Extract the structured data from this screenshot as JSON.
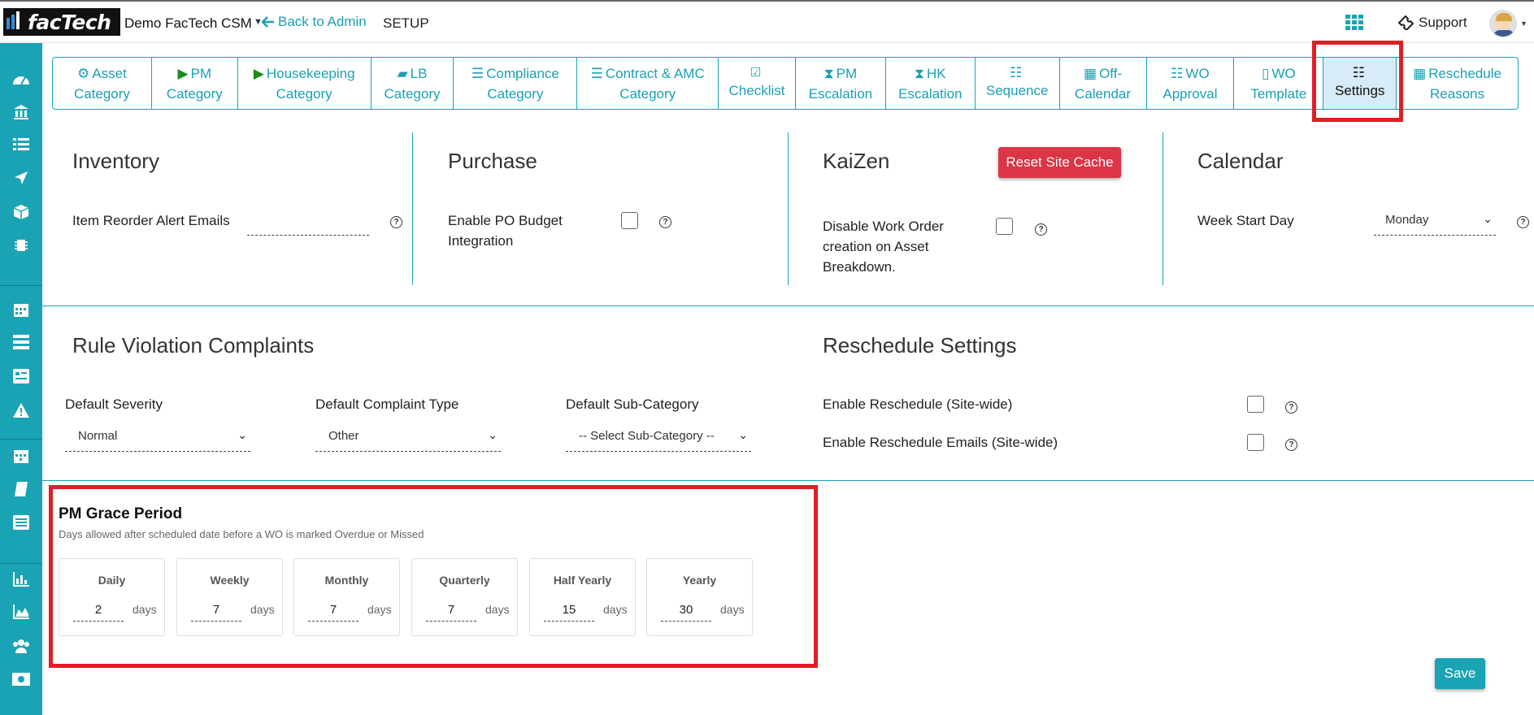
{
  "header": {
    "site_name": "Demo FacTech CSM",
    "back_link": "Back to Admin",
    "section": "SETUP",
    "support": "Support",
    "logo_text": "facTech"
  },
  "tabs": [
    {
      "label": "Asset Category",
      "icon": "cubes-icon"
    },
    {
      "label": "PM Category",
      "icon": "play-icon"
    },
    {
      "label": "Housekeeping Category",
      "icon": "play-icon"
    },
    {
      "label": "LB Category",
      "icon": "book-icon"
    },
    {
      "label": "Compliance Category",
      "icon": "list-icon"
    },
    {
      "label": "Contract & AMC Category",
      "icon": "list-icon"
    },
    {
      "label": "Checklist",
      "icon": "check-square-icon"
    },
    {
      "label": "PM Escalation",
      "icon": "hourglass-icon"
    },
    {
      "label": "HK Escalation",
      "icon": "hourglass-icon"
    },
    {
      "label": "Sequence",
      "icon": "list-ol-icon"
    },
    {
      "label": "Off-Calendar",
      "icon": "calendar-icon"
    },
    {
      "label": "WO Approval",
      "icon": "list-ol-icon"
    },
    {
      "label": "WO Template",
      "icon": "file-pdf-icon"
    },
    {
      "label": "Settings",
      "icon": "list-ol-icon",
      "active": true
    },
    {
      "label": "Reschedule Reasons",
      "icon": "calendar-icon"
    }
  ],
  "inventory": {
    "title": "Inventory",
    "reorder_label": "Item Reorder Alert Emails",
    "reorder_value": ""
  },
  "purchase": {
    "title": "Purchase",
    "po_budget_label": "Enable PO Budget Integration"
  },
  "kaizen": {
    "title": "KaiZen",
    "reset_button": "Reset Site Cache",
    "disable_wo_label": "Disable Work Order creation on Asset Breakdown."
  },
  "calendar": {
    "title": "Calendar",
    "week_start_label": "Week Start Day",
    "week_start_value": "Monday"
  },
  "rule_violation": {
    "title": "Rule Violation Complaints",
    "severity_label": "Default Severity",
    "severity_value": "Normal",
    "complaint_type_label": "Default Complaint Type",
    "complaint_type_value": "Other",
    "subcategory_label": "Default Sub-Category",
    "subcategory_value": "-- Select Sub-Category --"
  },
  "reschedule": {
    "title": "Reschedule Settings",
    "enable_label": "Enable Reschedule (Site-wide)",
    "emails_label": "Enable Reschedule Emails (Site-wide)"
  },
  "grace": {
    "title": "PM Grace Period",
    "subtitle": "Days allowed after scheduled date before a WO is marked Overdue or Missed",
    "unit": "days",
    "periods": [
      {
        "name": "Daily",
        "value": "2"
      },
      {
        "name": "Weekly",
        "value": "7"
      },
      {
        "name": "Monthly",
        "value": "7"
      },
      {
        "name": "Quarterly",
        "value": "7"
      },
      {
        "name": "Half Yearly",
        "value": "15"
      },
      {
        "name": "Yearly",
        "value": "30"
      }
    ]
  },
  "save_button": "Save",
  "colors": {
    "accent": "#1aa3b5",
    "danger": "#dc3545",
    "highlight": "#e01e26"
  }
}
